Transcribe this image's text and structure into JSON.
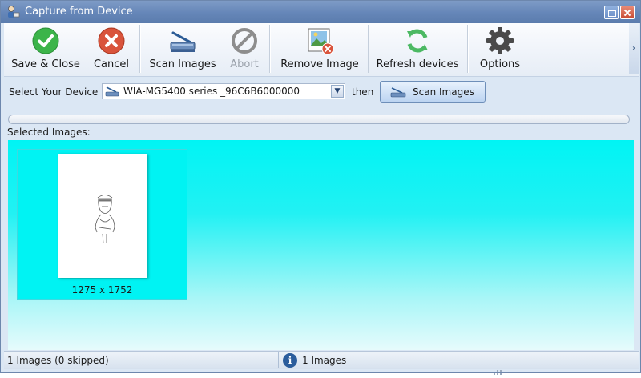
{
  "window": {
    "title": "Capture from Device"
  },
  "toolbar": {
    "save_close": "Save & Close",
    "cancel": "Cancel",
    "scan_images": "Scan Images",
    "abort": "Abort",
    "remove_image": "Remove Image",
    "refresh_devices": "Refresh devices",
    "options": "Options",
    "more_arrow": "›"
  },
  "device": {
    "label": "Select Your Device",
    "selected": "WIA-MG5400 series _96C6B6000000",
    "then": "then",
    "scan_button": "Scan Images"
  },
  "gallery": {
    "label": "Selected Images:",
    "items": [
      {
        "dimensions": "1275 x 1752"
      }
    ]
  },
  "status": {
    "left": "1 Images (0 skipped)",
    "info_glyph": "i",
    "right": "1 Images"
  },
  "colors": {
    "accent_cyan": "#00f4f4",
    "save_green": "#3cb44a",
    "cancel_red": "#d9543c",
    "refresh_green": "#4cb963"
  },
  "icons": {
    "save": "check-circle-icon",
    "cancel": "x-circle-icon",
    "scan": "scanner-icon",
    "abort": "no-entry-icon",
    "remove": "image-remove-icon",
    "refresh": "refresh-icon",
    "options": "gear-icon",
    "info": "info-icon"
  }
}
